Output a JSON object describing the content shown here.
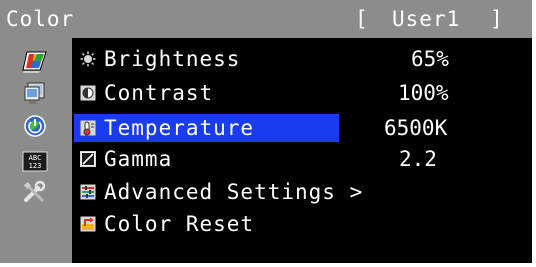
{
  "header": {
    "title": "Color",
    "bracket_left": "[",
    "mode": "User1",
    "bracket_right": "]"
  },
  "sidebar": {
    "items": [
      {
        "name": "color-icon"
      },
      {
        "name": "screen-icon"
      },
      {
        "name": "power-eco-icon"
      },
      {
        "name": "osd-text-icon"
      },
      {
        "name": "tools-icon"
      }
    ]
  },
  "menu": {
    "items": [
      {
        "label": "Brightness",
        "value": "65%",
        "icon": "brightness-icon"
      },
      {
        "label": "Contrast",
        "value": "100%",
        "icon": "contrast-icon"
      },
      {
        "label": "Temperature",
        "value": "6500K",
        "icon": "temperature-icon",
        "selected": true
      },
      {
        "label": "Gamma",
        "value": "2.2",
        "icon": "gamma-icon"
      },
      {
        "label": "Advanced Settings >",
        "value": "",
        "icon": "advanced-settings-icon"
      },
      {
        "label": "Color Reset",
        "value": "",
        "icon": "color-reset-icon"
      }
    ]
  },
  "colors": {
    "selection": "#1a3cf0",
    "panel_gray": "#8c8c8c",
    "background": "#000000"
  }
}
